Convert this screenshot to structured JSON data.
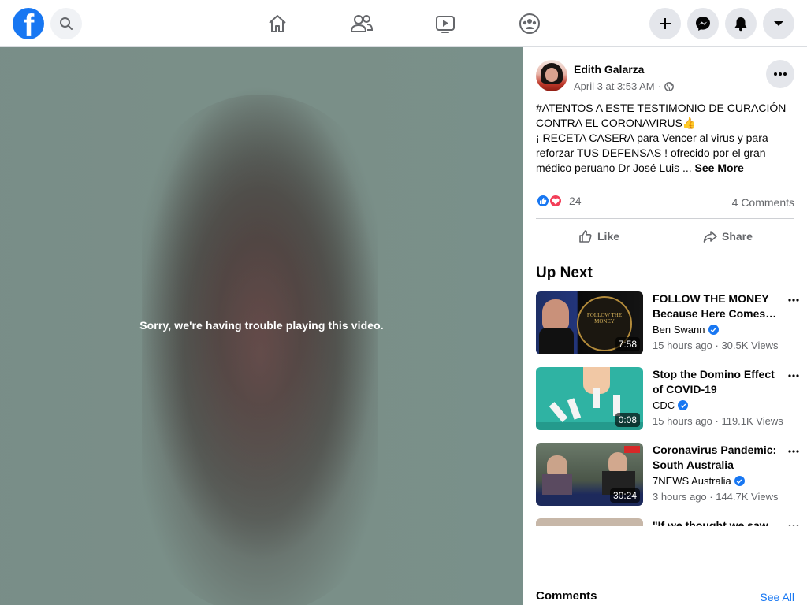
{
  "header": {
    "logo_letter": "f",
    "brand_color": "#1877f2",
    "nav_icons": [
      "home-icon",
      "friends-icon",
      "watch-icon",
      "groups-icon"
    ],
    "right_buttons": [
      "create-icon",
      "messenger-icon",
      "notifications-icon",
      "account-menu-icon"
    ]
  },
  "video": {
    "error_message": "Sorry, we're having trouble playing this video."
  },
  "post": {
    "author": "Edith Galarza",
    "timestamp": "April 3 at 3:53 AM",
    "separator": "·",
    "privacy_icon": "globe-icon",
    "text_line1": "#ATENTOS A ESTE TESTIMONIO DE CURACIÓN CONTRA EL CORONAVIRUS👍",
    "text_line2": "¡ RECETA CASERA para Vencer al virus y para reforzar TUS DEFENSAS ! ofrecido por el gran médico peruano Dr José Luis ...",
    "see_more": "See More",
    "reaction_count": "24",
    "comments_count": "4 Comments",
    "like_label": "Like",
    "share_label": "Share"
  },
  "up_next": {
    "heading": "Up Next",
    "items": [
      {
        "title": "FOLLOW THE MONEY Because Here Comes the Mandatory Coronavirus Vaccine",
        "channel": "Ben Swann",
        "verified": true,
        "meta": "15 hours ago · 30.5K Views",
        "duration": "7:58"
      },
      {
        "title": "Stop the Domino Effect of COVID-19",
        "channel": "CDC",
        "verified": true,
        "meta": "15 hours ago · 119.1K Views",
        "duration": "0:08"
      },
      {
        "title": "Coronavirus Pandemic: South Australia",
        "channel": "7NEWS Australia",
        "verified": true,
        "meta": "3 hours ago · 144.7K Views",
        "duration": "30:24"
      },
      {
        "title": "\"If we thought we saw",
        "channel": "",
        "verified": false,
        "meta": "",
        "duration": ""
      }
    ]
  },
  "comments": {
    "label": "Comments",
    "see_all": "See All"
  }
}
